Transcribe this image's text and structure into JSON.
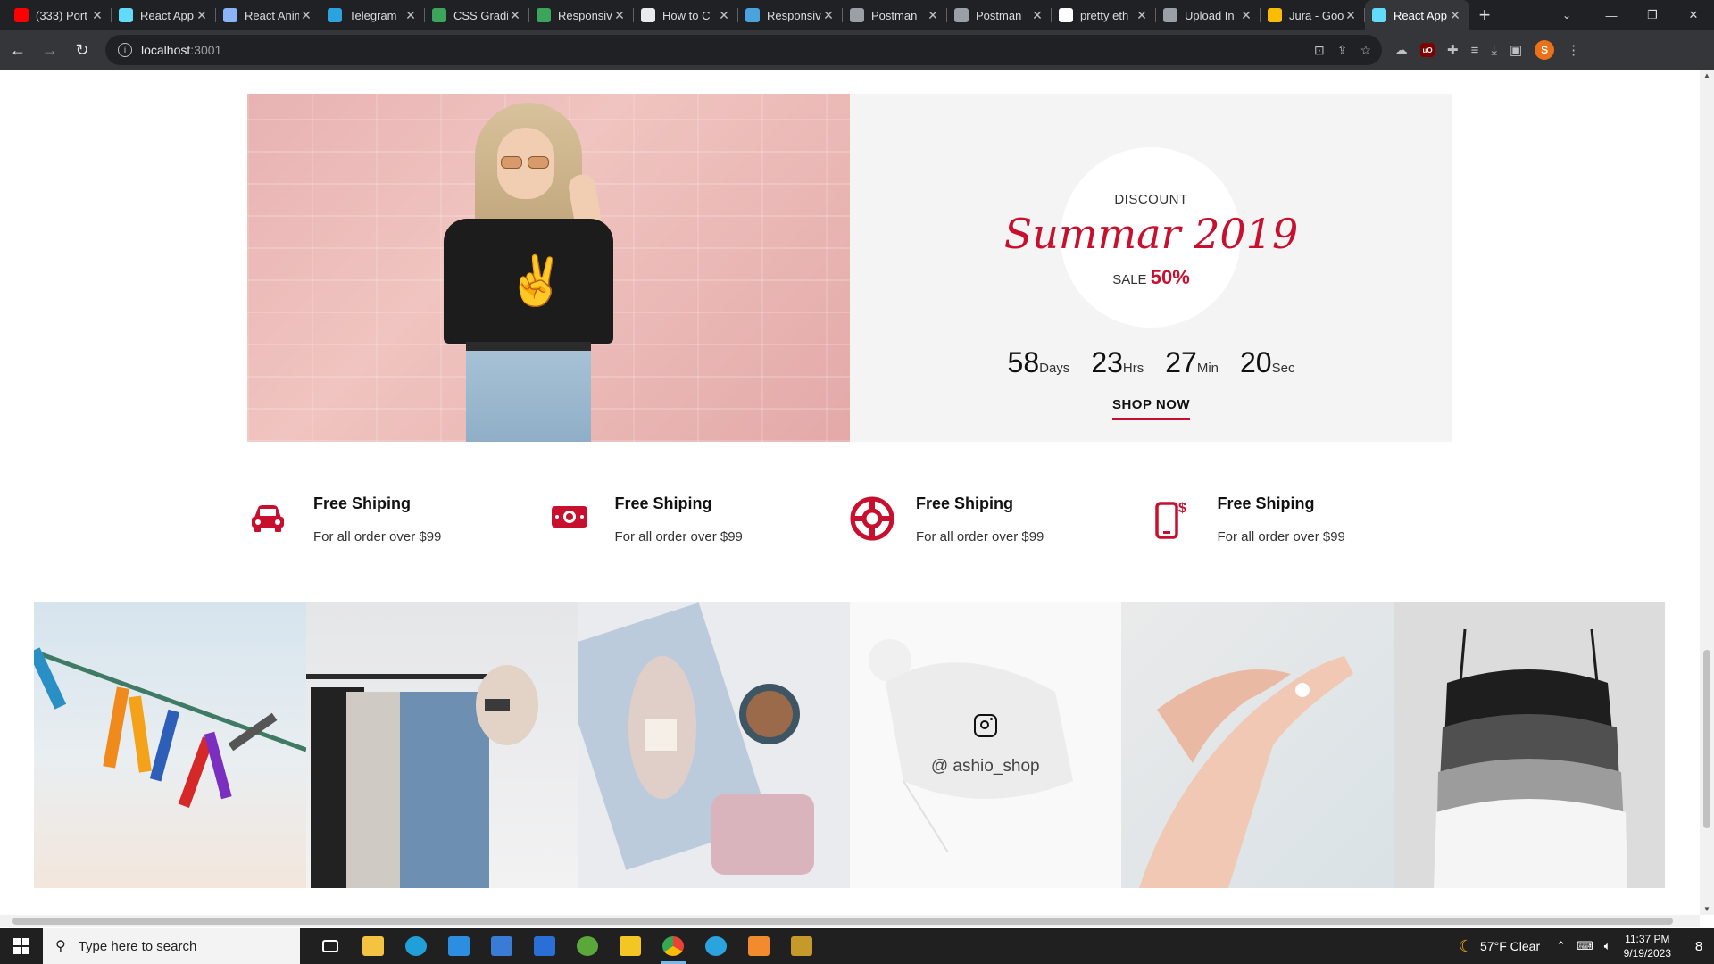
{
  "browser": {
    "tabs": [
      {
        "title": "(333) Port",
        "icon": "youtube-icon",
        "color": "#ff0000"
      },
      {
        "title": "React App",
        "icon": "react-icon",
        "color": "#61dafb"
      },
      {
        "title": "React Anim",
        "icon": "page-icon",
        "color": "#8ab4f8"
      },
      {
        "title": "Telegram",
        "icon": "telegram-icon",
        "color": "#2aa3df"
      },
      {
        "title": "CSS Gradi",
        "icon": "w-icon",
        "color": "#3ba55c"
      },
      {
        "title": "Responsiv",
        "icon": "w-icon",
        "color": "#3ba55c"
      },
      {
        "title": "How to C",
        "icon": "doc-icon",
        "color": "#e8eaed"
      },
      {
        "title": "Responsiv",
        "icon": "wave-icon",
        "color": "#4aa3df"
      },
      {
        "title": "Postman",
        "icon": "postman-icon",
        "color": "#9aa0a6"
      },
      {
        "title": "Postman",
        "icon": "postman-icon",
        "color": "#9aa0a6"
      },
      {
        "title": "pretty eth",
        "icon": "google-icon",
        "color": "#ffffff"
      },
      {
        "title": "Upload In",
        "icon": "layers-icon",
        "color": "#9aa0a6"
      },
      {
        "title": "Jura - Goo",
        "icon": "gdrive-icon",
        "color": "#fbbc04"
      },
      {
        "title": "React App",
        "icon": "react-icon",
        "color": "#61dafb",
        "active": true
      }
    ],
    "url_host": "localhost",
    "url_port": ":3001",
    "profile_initial": "S"
  },
  "hero": {
    "discount_label": "DISCOUNT",
    "headline": "Summar 2019",
    "sale_label": "SALE",
    "sale_value": "50%",
    "countdown": [
      {
        "value": "58",
        "unit": "Days"
      },
      {
        "value": "23",
        "unit": "Hrs"
      },
      {
        "value": "27",
        "unit": "Min"
      },
      {
        "value": "20",
        "unit": "Sec"
      }
    ],
    "cta": "SHOP NOW",
    "accent_color": "#c8102e"
  },
  "features": [
    {
      "icon": "car-icon",
      "title": "Free Shiping",
      "desc": "For all order over $99"
    },
    {
      "icon": "money-icon",
      "title": "Free Shiping",
      "desc": "For all order over $99"
    },
    {
      "icon": "lifebuoy-icon",
      "title": "Free Shiping",
      "desc": "For all order over $99"
    },
    {
      "icon": "mobile-payment-icon",
      "title": "Free Shiping",
      "desc": "For all order over $99"
    }
  ],
  "gallery": {
    "handle": "@ ashio_shop",
    "tiles": [
      "clothespins-photo",
      "clothing-rack-photo",
      "denim-yarn-coffee-photo",
      "knit-hat-photo",
      "hand-lotion-photo",
      "camisoles-photo"
    ]
  },
  "taskbar": {
    "search_placeholder": "Type here to search",
    "weather": "57°F  Clear",
    "time": "11:37 PM",
    "date": "9/19/2023",
    "notifications": "8"
  }
}
